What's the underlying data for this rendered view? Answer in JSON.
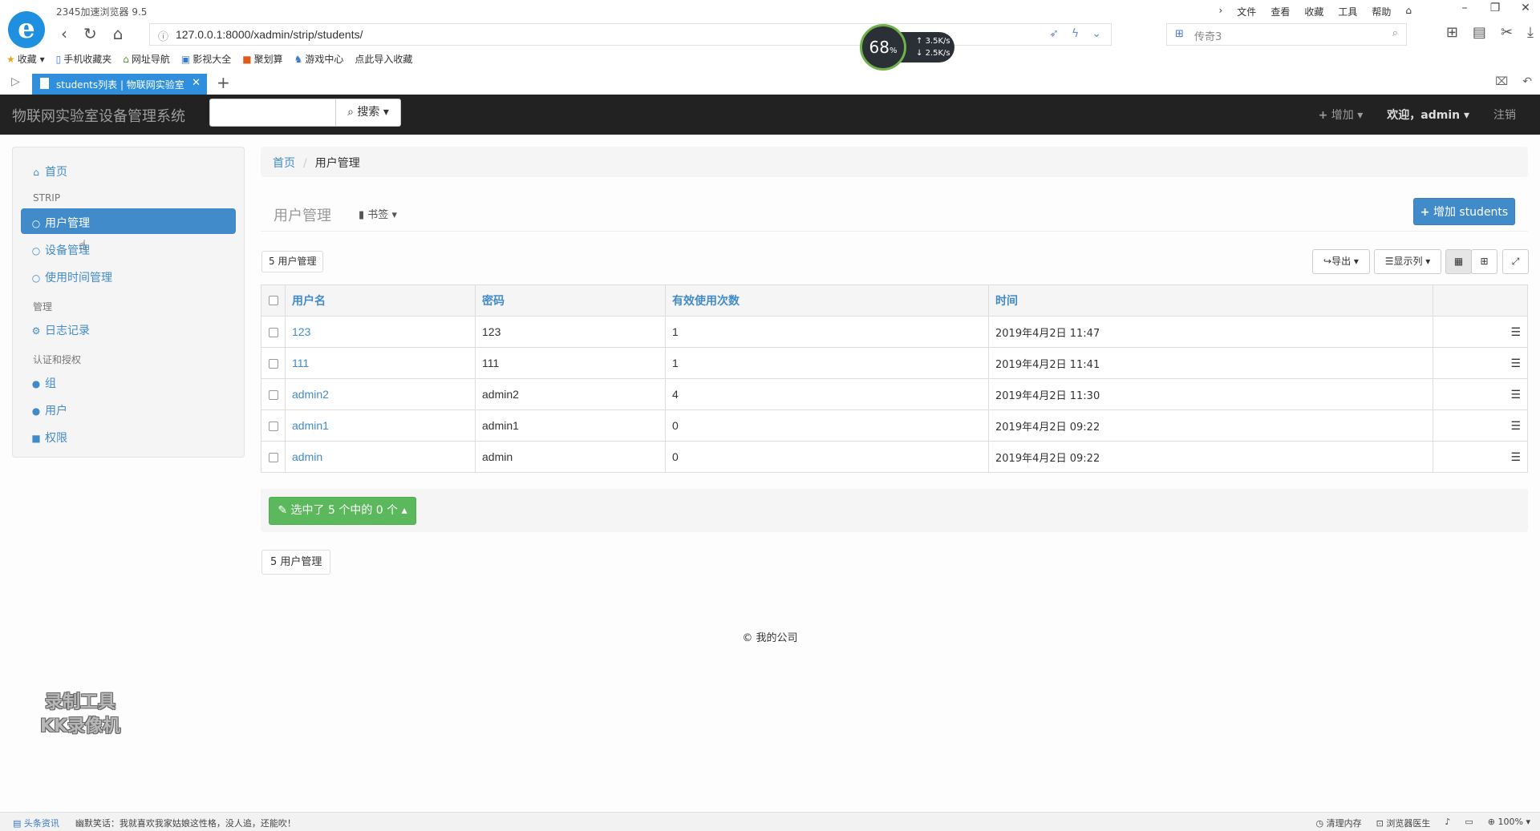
{
  "browser": {
    "title": "2345加速浏览器 9.5",
    "menu": [
      "文件",
      "查看",
      "收藏",
      "工具",
      "帮助"
    ],
    "url": "127.0.0.1:8000/xadmin/strip/students/",
    "speed_percent": "68",
    "speed_unit": "%",
    "upload": "3.5K/s",
    "download": "2.5K/s",
    "search_query": "传奇3",
    "bookmarks": [
      "收藏",
      "手机收藏夹",
      "网址导航",
      "影视大全",
      "聚划算",
      "游戏中心",
      "点此导入收藏"
    ],
    "tab_title": "students列表 | 物联网实验室",
    "status_left": [
      "头条资讯",
      "幽默笑话：我就喜欢我家姑娘这性格，没人追，还能吹！"
    ],
    "status_right": [
      "清理内存",
      "浏览器医生",
      "100%"
    ]
  },
  "app": {
    "brand": "物联网实验室设备管理系统",
    "search_btn": "搜索",
    "nav_add": "增加",
    "nav_welcome": "欢迎，admin",
    "nav_logout": "注销"
  },
  "sidebar": {
    "home": "首页",
    "section_strip": "STRIP",
    "items_strip": [
      "用户管理",
      "设备管理",
      "使用时间管理"
    ],
    "section_manage": "管理",
    "log": "日志记录",
    "section_auth": "认证和授权",
    "auth_items": [
      "组",
      "用户",
      "权限"
    ]
  },
  "main": {
    "breadcrumb_home": "首页",
    "breadcrumb_current": "用户管理",
    "page_title": "用户管理",
    "bookmark_label": "书签",
    "add_button": "增加 students",
    "count_top": "5 用户管理",
    "export_label": "导出",
    "columns_label": "显示列",
    "table": {
      "headers": [
        "用户名",
        "密码",
        "有效使用次数",
        "时间"
      ],
      "rows": [
        {
          "username": "123",
          "password": "123",
          "uses": "1",
          "time": "2019年4月2日 11:47"
        },
        {
          "username": "111",
          "password": "111",
          "uses": "1",
          "time": "2019年4月2日 11:41"
        },
        {
          "username": "admin2",
          "password": "admin2",
          "uses": "4",
          "time": "2019年4月2日 11:30"
        },
        {
          "username": "admin1",
          "password": "admin1",
          "uses": "0",
          "time": "2019年4月2日 09:22"
        },
        {
          "username": "admin",
          "password": "admin",
          "uses": "0",
          "time": "2019年4月2日 09:22"
        }
      ]
    },
    "selection_action": "选中了 5 个中的 0 个",
    "count_bottom": "5 用户管理",
    "footer": "© 我的公司"
  },
  "watermark": [
    "录制工具",
    "KK录像机"
  ],
  "colors": {
    "primary": "#428bca",
    "success": "#5cb85c",
    "navbar": "#222222",
    "tab_active": "#2f8fdd"
  }
}
